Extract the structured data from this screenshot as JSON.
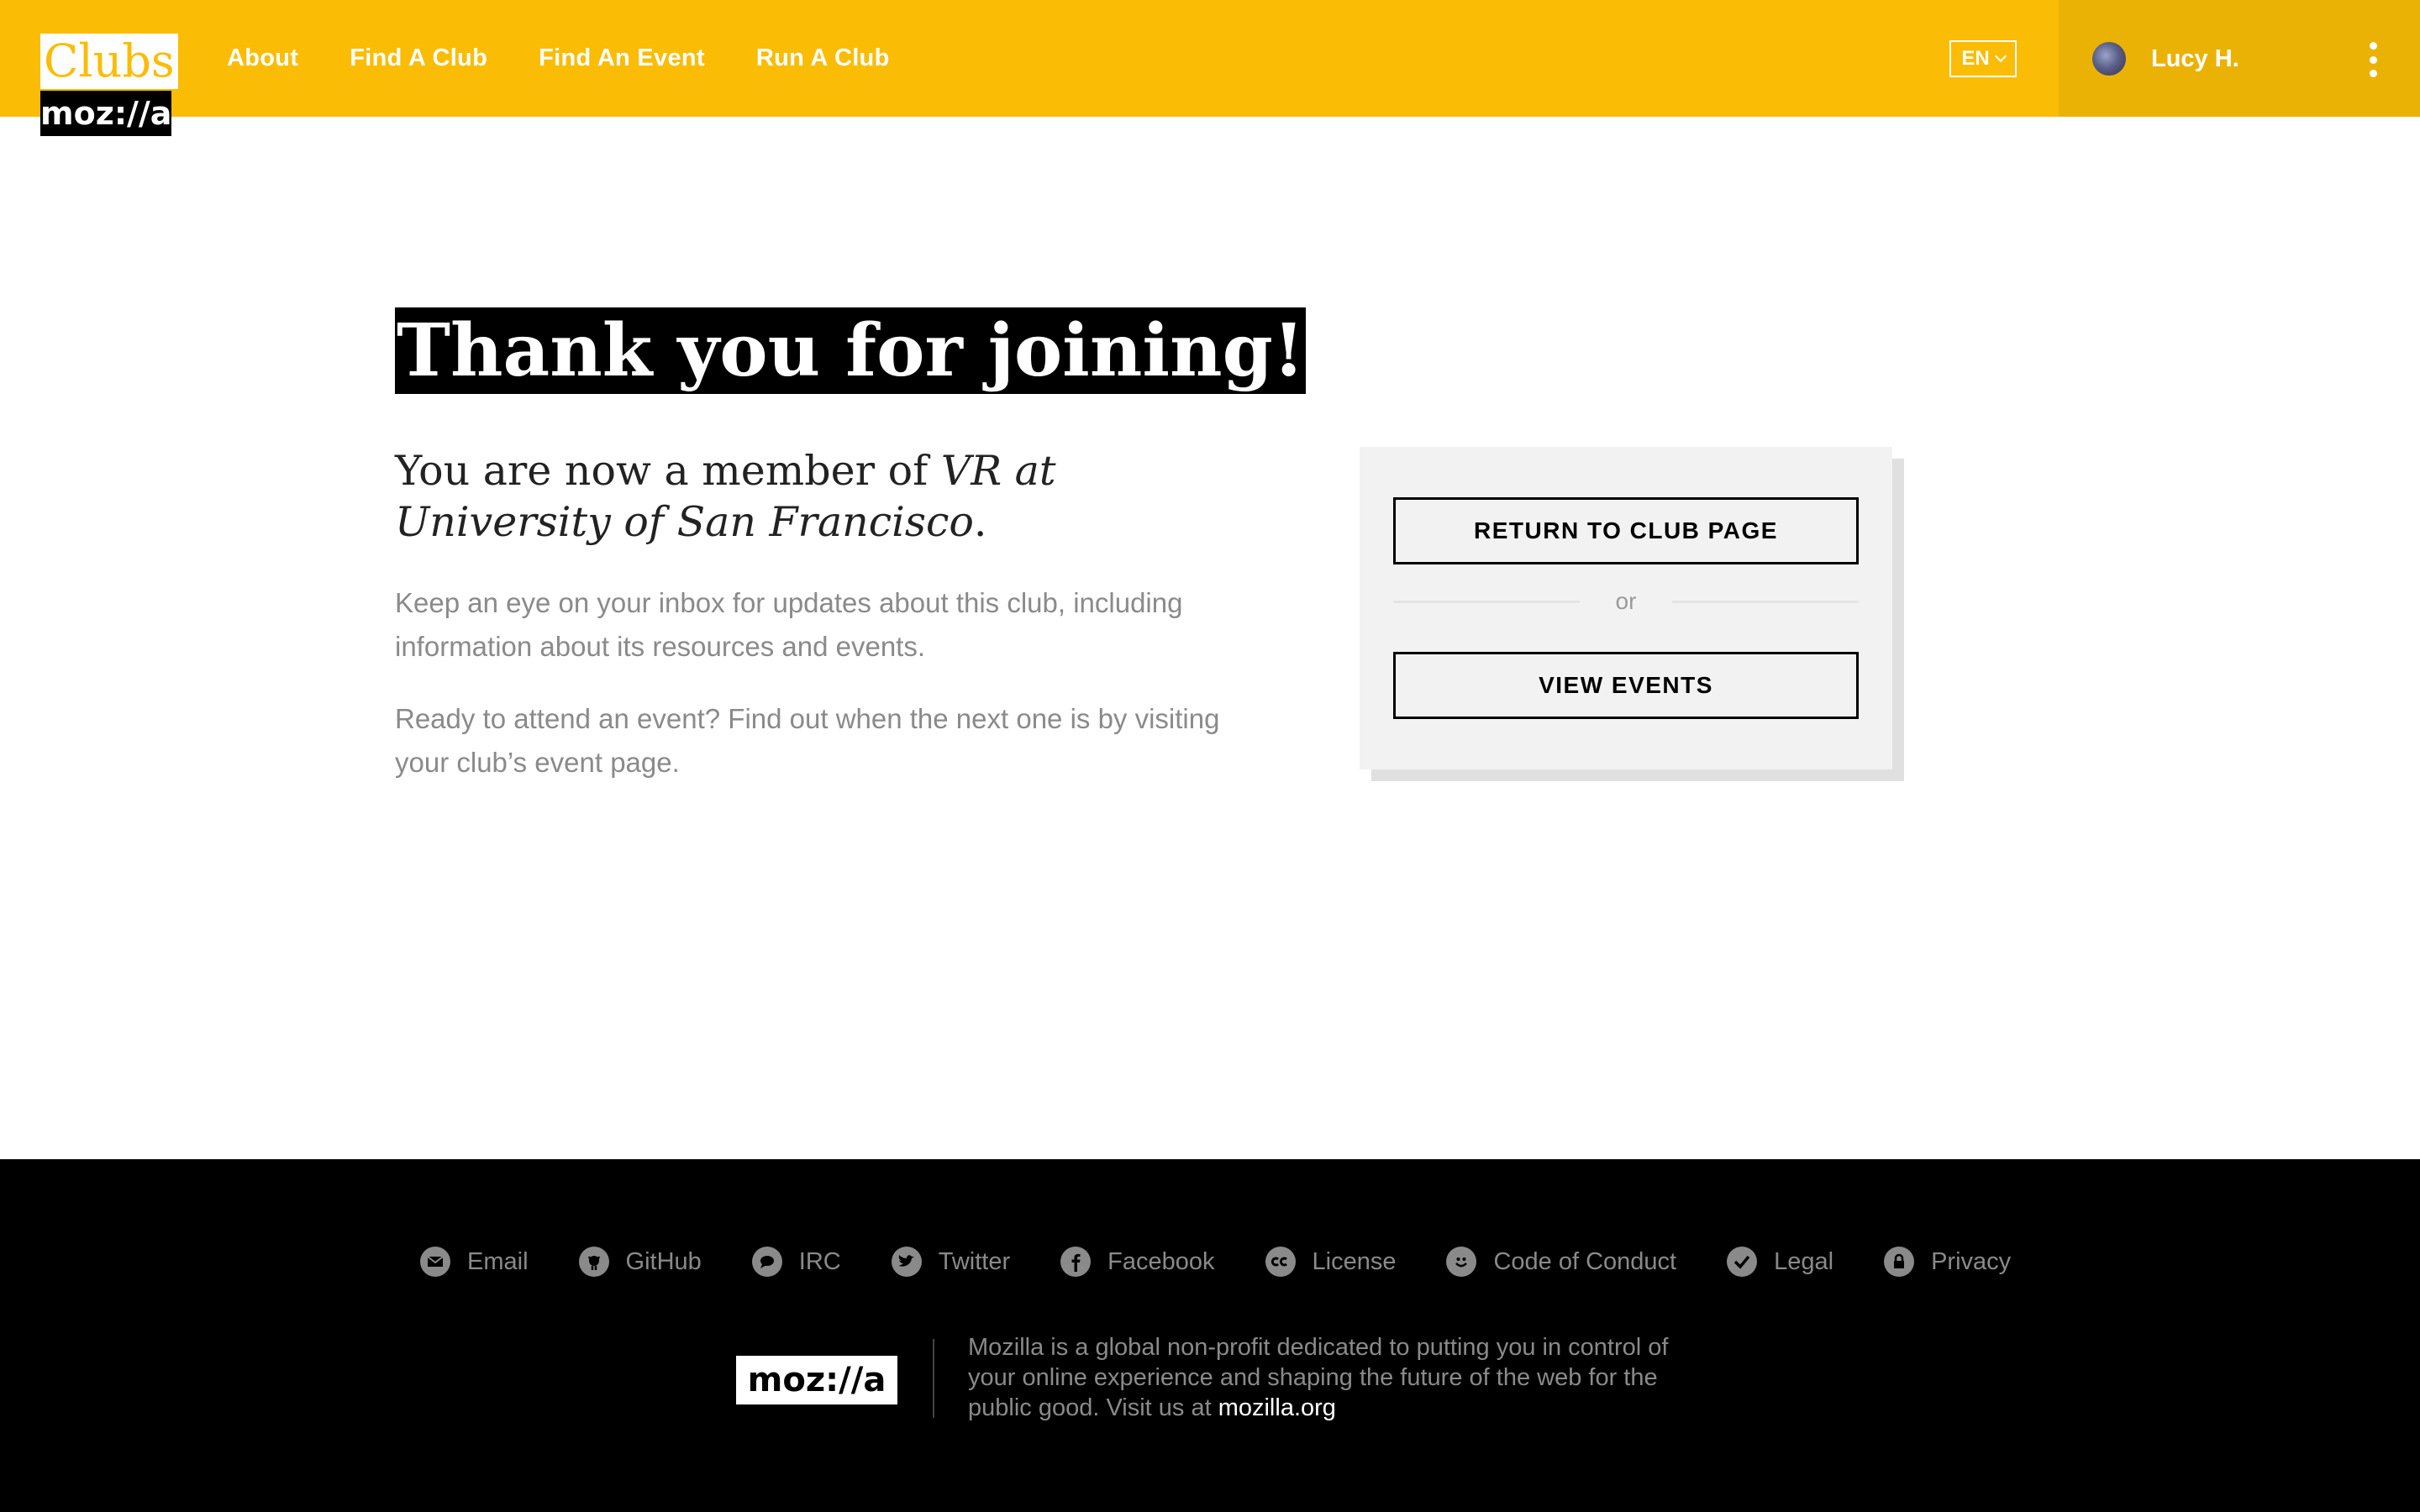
{
  "header": {
    "logo_clubs": "Clubs",
    "logo_mozilla": "moz://a",
    "nav": [
      {
        "label": "About"
      },
      {
        "label": "Find A Club"
      },
      {
        "label": "Find An Event"
      },
      {
        "label": "Run A Club"
      }
    ],
    "language": "EN",
    "user_name": "Lucy H."
  },
  "main": {
    "title": "Thank you for joining!",
    "subtitle_prefix": "You are now a member of ",
    "club_name": "VR at University of San Francisco",
    "subtitle_suffix": ".",
    "paragraph1": "Keep an eye on your inbox for updates about this club, including information about its resources and events.",
    "paragraph2": "Ready to attend an event? Find out when the next one is by visiting your club’s event page."
  },
  "card": {
    "return_button": "RETURN TO CLUB PAGE",
    "or_text": "or",
    "events_button": "VIEW EVENTS"
  },
  "footer": {
    "links": [
      {
        "label": "Email",
        "icon": "email-icon"
      },
      {
        "label": "GitHub",
        "icon": "github-icon"
      },
      {
        "label": "IRC",
        "icon": "chat-bubble-icon"
      },
      {
        "label": "Twitter",
        "icon": "twitter-icon"
      },
      {
        "label": "Facebook",
        "icon": "facebook-icon"
      },
      {
        "label": "License",
        "icon": "creative-commons-icon"
      },
      {
        "label": "Code of Conduct",
        "icon": "smiley-icon"
      },
      {
        "label": "Legal",
        "icon": "checkmark-icon"
      },
      {
        "label": "Privacy",
        "icon": "lock-icon"
      }
    ],
    "logo": "moz://a",
    "description": "Mozilla is a global non-profit dedicated to putting you in control of your online experience and shaping the future of the web for the public good. Visit us at ",
    "site_link": "mozilla.org"
  },
  "colors": {
    "brand_yellow": "#fbbc05",
    "user_area_yellow": "#ebb206",
    "footer_bg": "#000000",
    "muted_text": "#8a8a8a"
  }
}
